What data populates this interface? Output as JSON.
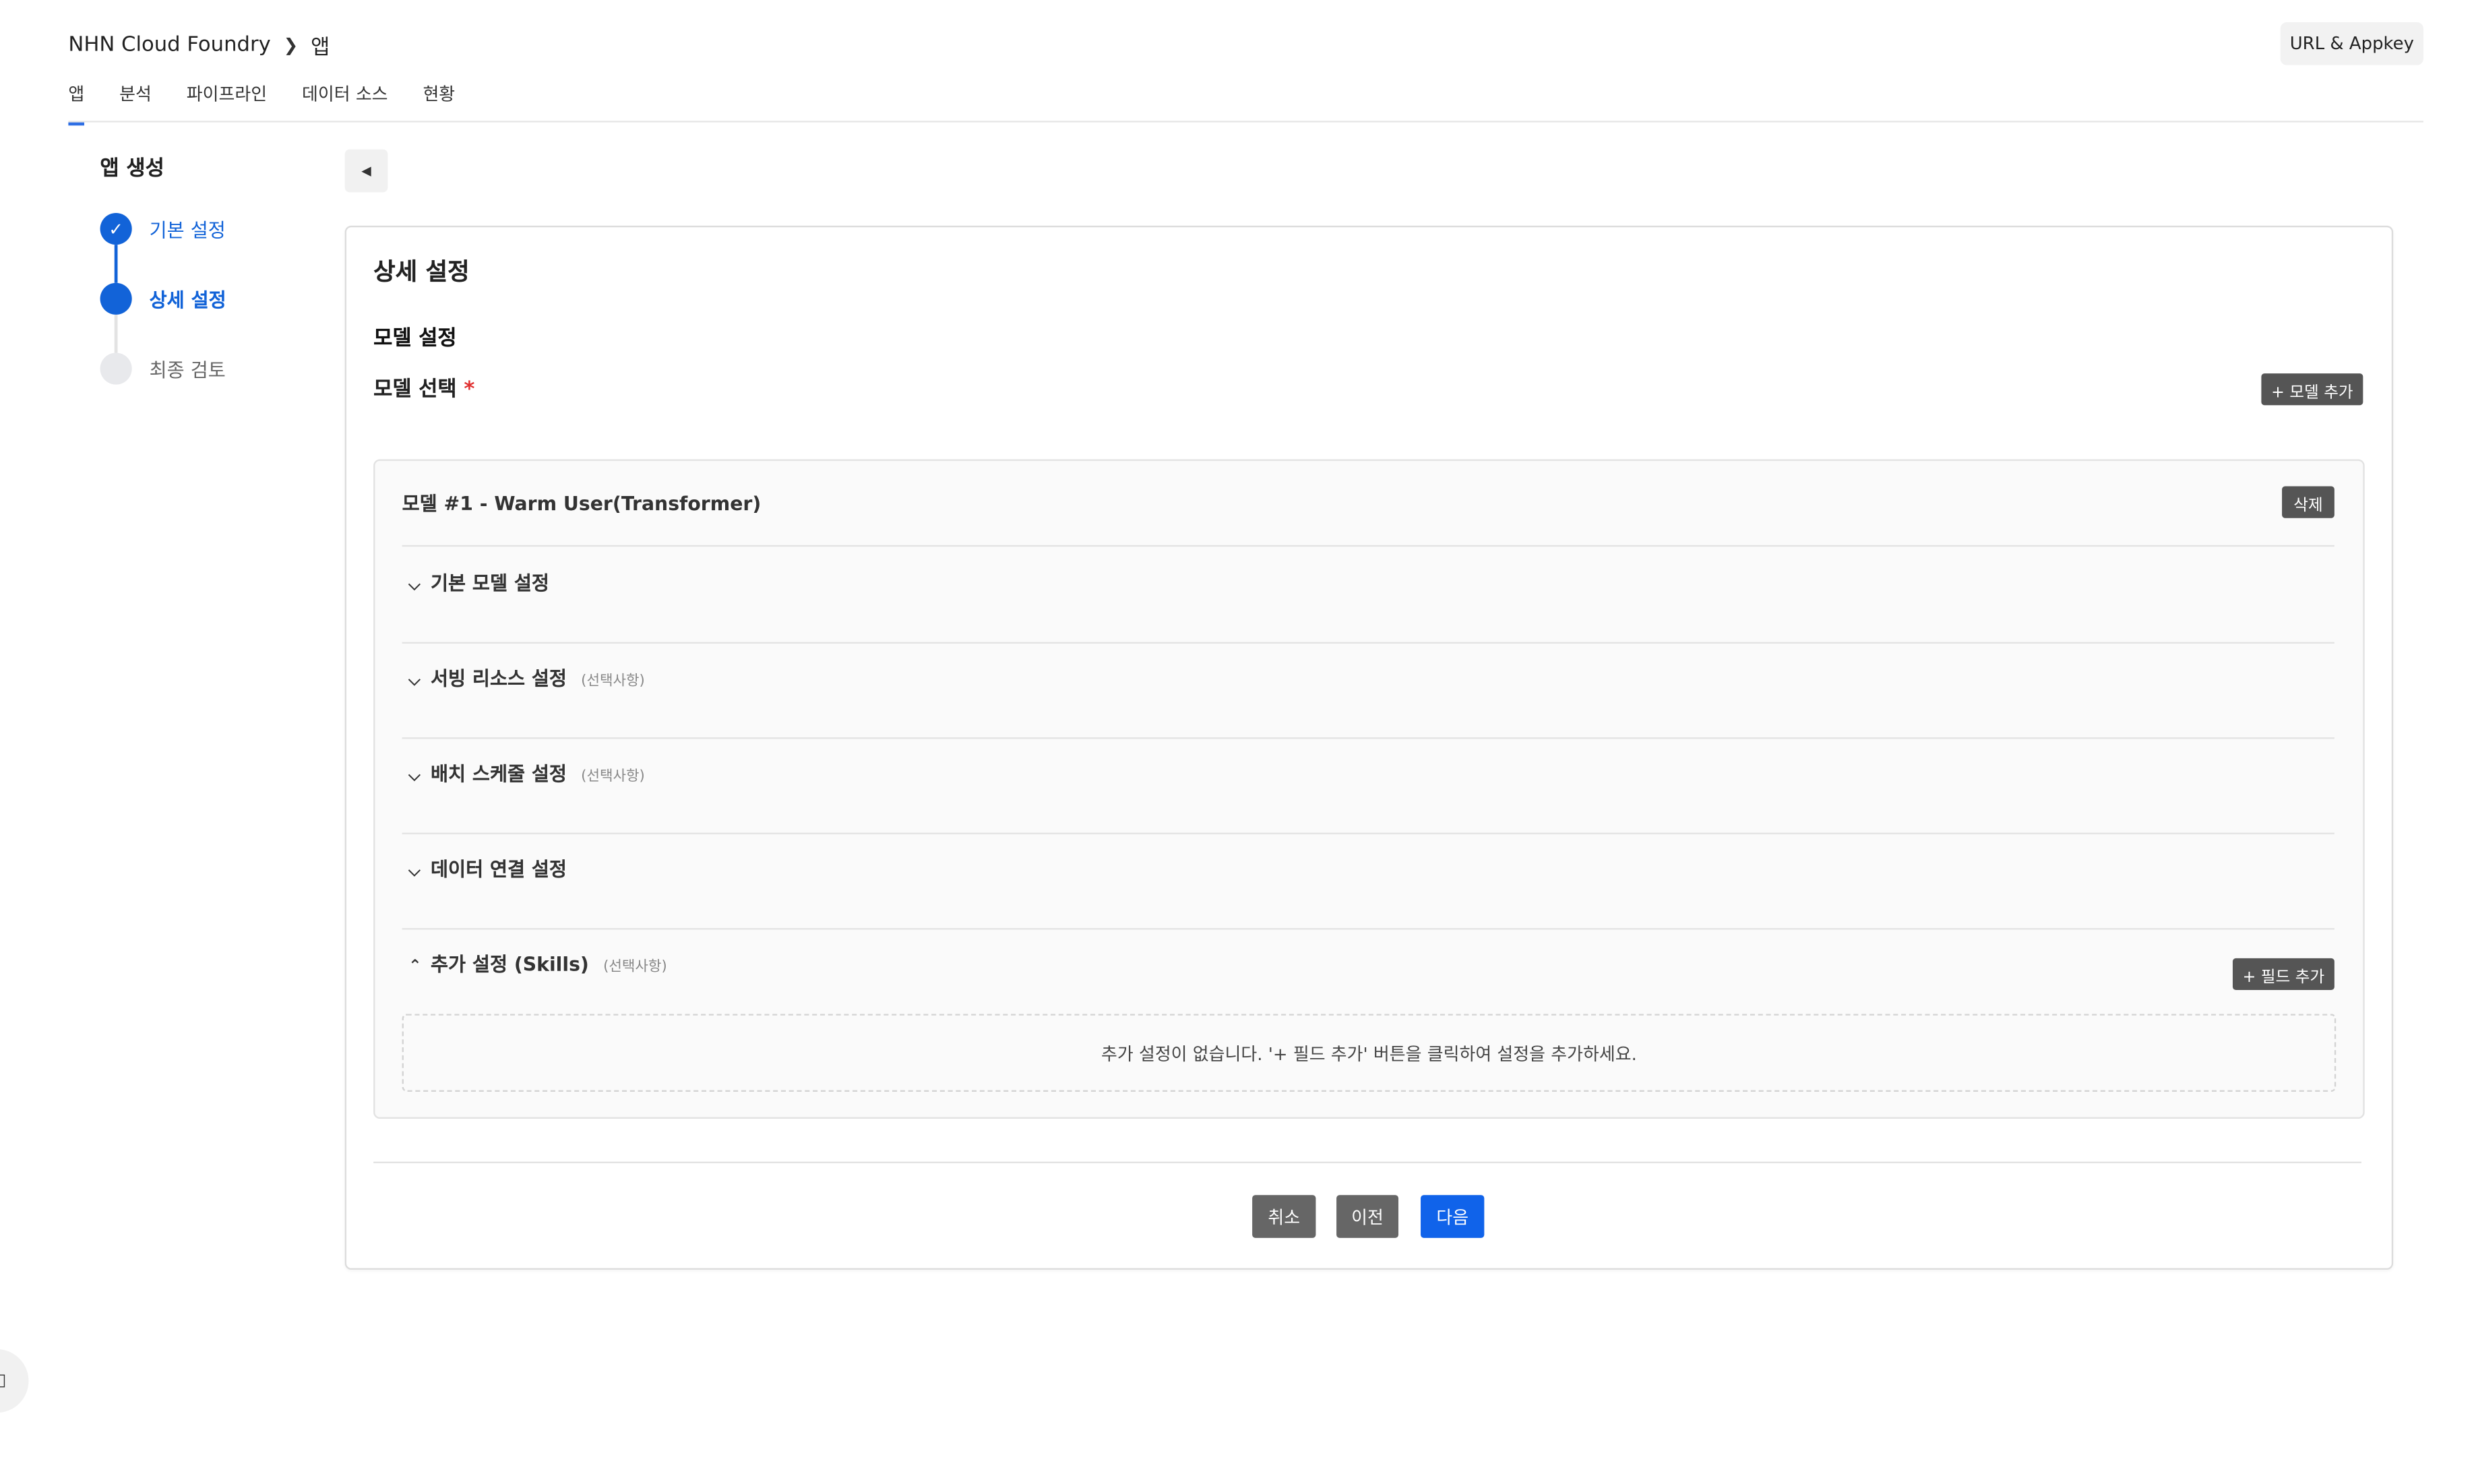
{
  "header": {
    "breadcrumb": [
      "NHN Cloud Foundry",
      "앱"
    ],
    "url_appkey_button": "URL & Appkey"
  },
  "tabs": [
    {
      "label": "앱",
      "active": true
    },
    {
      "label": "분석",
      "active": false
    },
    {
      "label": "파이프라인",
      "active": false
    },
    {
      "label": "데이터 소스",
      "active": false
    },
    {
      "label": "현황",
      "active": false
    }
  ],
  "stepper": {
    "title": "앱 생성",
    "steps": [
      {
        "label": "기본 설정",
        "state": "completed"
      },
      {
        "label": "상세 설정",
        "state": "current"
      },
      {
        "label": "최종 검토",
        "state": "pending"
      }
    ]
  },
  "main": {
    "section_title": "상세 설정",
    "model_settings_title": "모델 설정",
    "model_select_label": "모델 선택",
    "required_mark": "*",
    "add_model_button": "+ 모델 추가",
    "model_panel": {
      "title": "모델 #1 - Warm User(Transformer)",
      "delete_button": "삭제",
      "sections": [
        {
          "label": "기본 모델 설정",
          "optional": "",
          "expanded": false
        },
        {
          "label": "서빙 리소스 설정",
          "optional": "(선택사항)",
          "expanded": false
        },
        {
          "label": "배치 스케줄 설정",
          "optional": "(선택사항)",
          "expanded": false
        },
        {
          "label": "데이터 연결 설정",
          "optional": "",
          "expanded": false
        },
        {
          "label": "추가 설정 (Skills)",
          "optional": "(선택사항)",
          "expanded": true
        }
      ],
      "add_field_button": "+ 필드 추가",
      "empty_message": "추가 설정이 없습니다. '+ 필드 추가' 버튼을 클릭하여 설정을 추가하세요."
    }
  },
  "footer": {
    "cancel": "취소",
    "prev": "이전",
    "next": "다음"
  },
  "icons": {
    "breadcrumb_separator": "chevron-right-icon",
    "back": "caret-left-icon",
    "step_done": "check-icon",
    "collapsed": "chevron-down-icon",
    "expanded": "chevron-up-icon",
    "floating": "panel-icon"
  },
  "colors": {
    "accent": "#1263d8",
    "primary_button": "#1063ea",
    "secondary_button": "#666666",
    "dark_button": "#555555",
    "required": "#e03131"
  }
}
